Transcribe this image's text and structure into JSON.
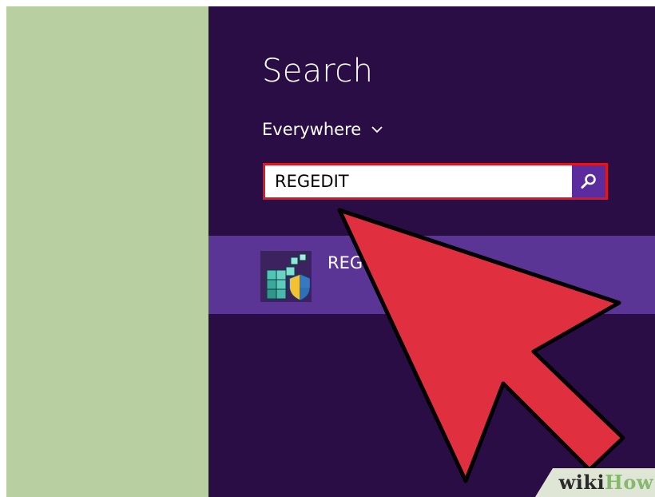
{
  "charm": {
    "title": "Search",
    "scope": {
      "label": "Everywhere",
      "chevron_icon": "chevron-down-icon"
    },
    "search": {
      "value": "REGEDIT",
      "button_icon": "search-magnifier-icon"
    },
    "result": {
      "label": "REG",
      "icon": "registry-editor-icon"
    }
  },
  "overlay": {
    "arrow_icon": "red-arrow-pointer",
    "arrow_color": "#e0303f",
    "highlight_color": "#e01520"
  },
  "watermark": {
    "wiki": "wiki",
    "how": "How"
  },
  "colors": {
    "left_pane": "#b8cfa1",
    "charm_background": "#2a0d45",
    "result_highlight": "#5b3596",
    "search_button": "#5b2c9e"
  }
}
